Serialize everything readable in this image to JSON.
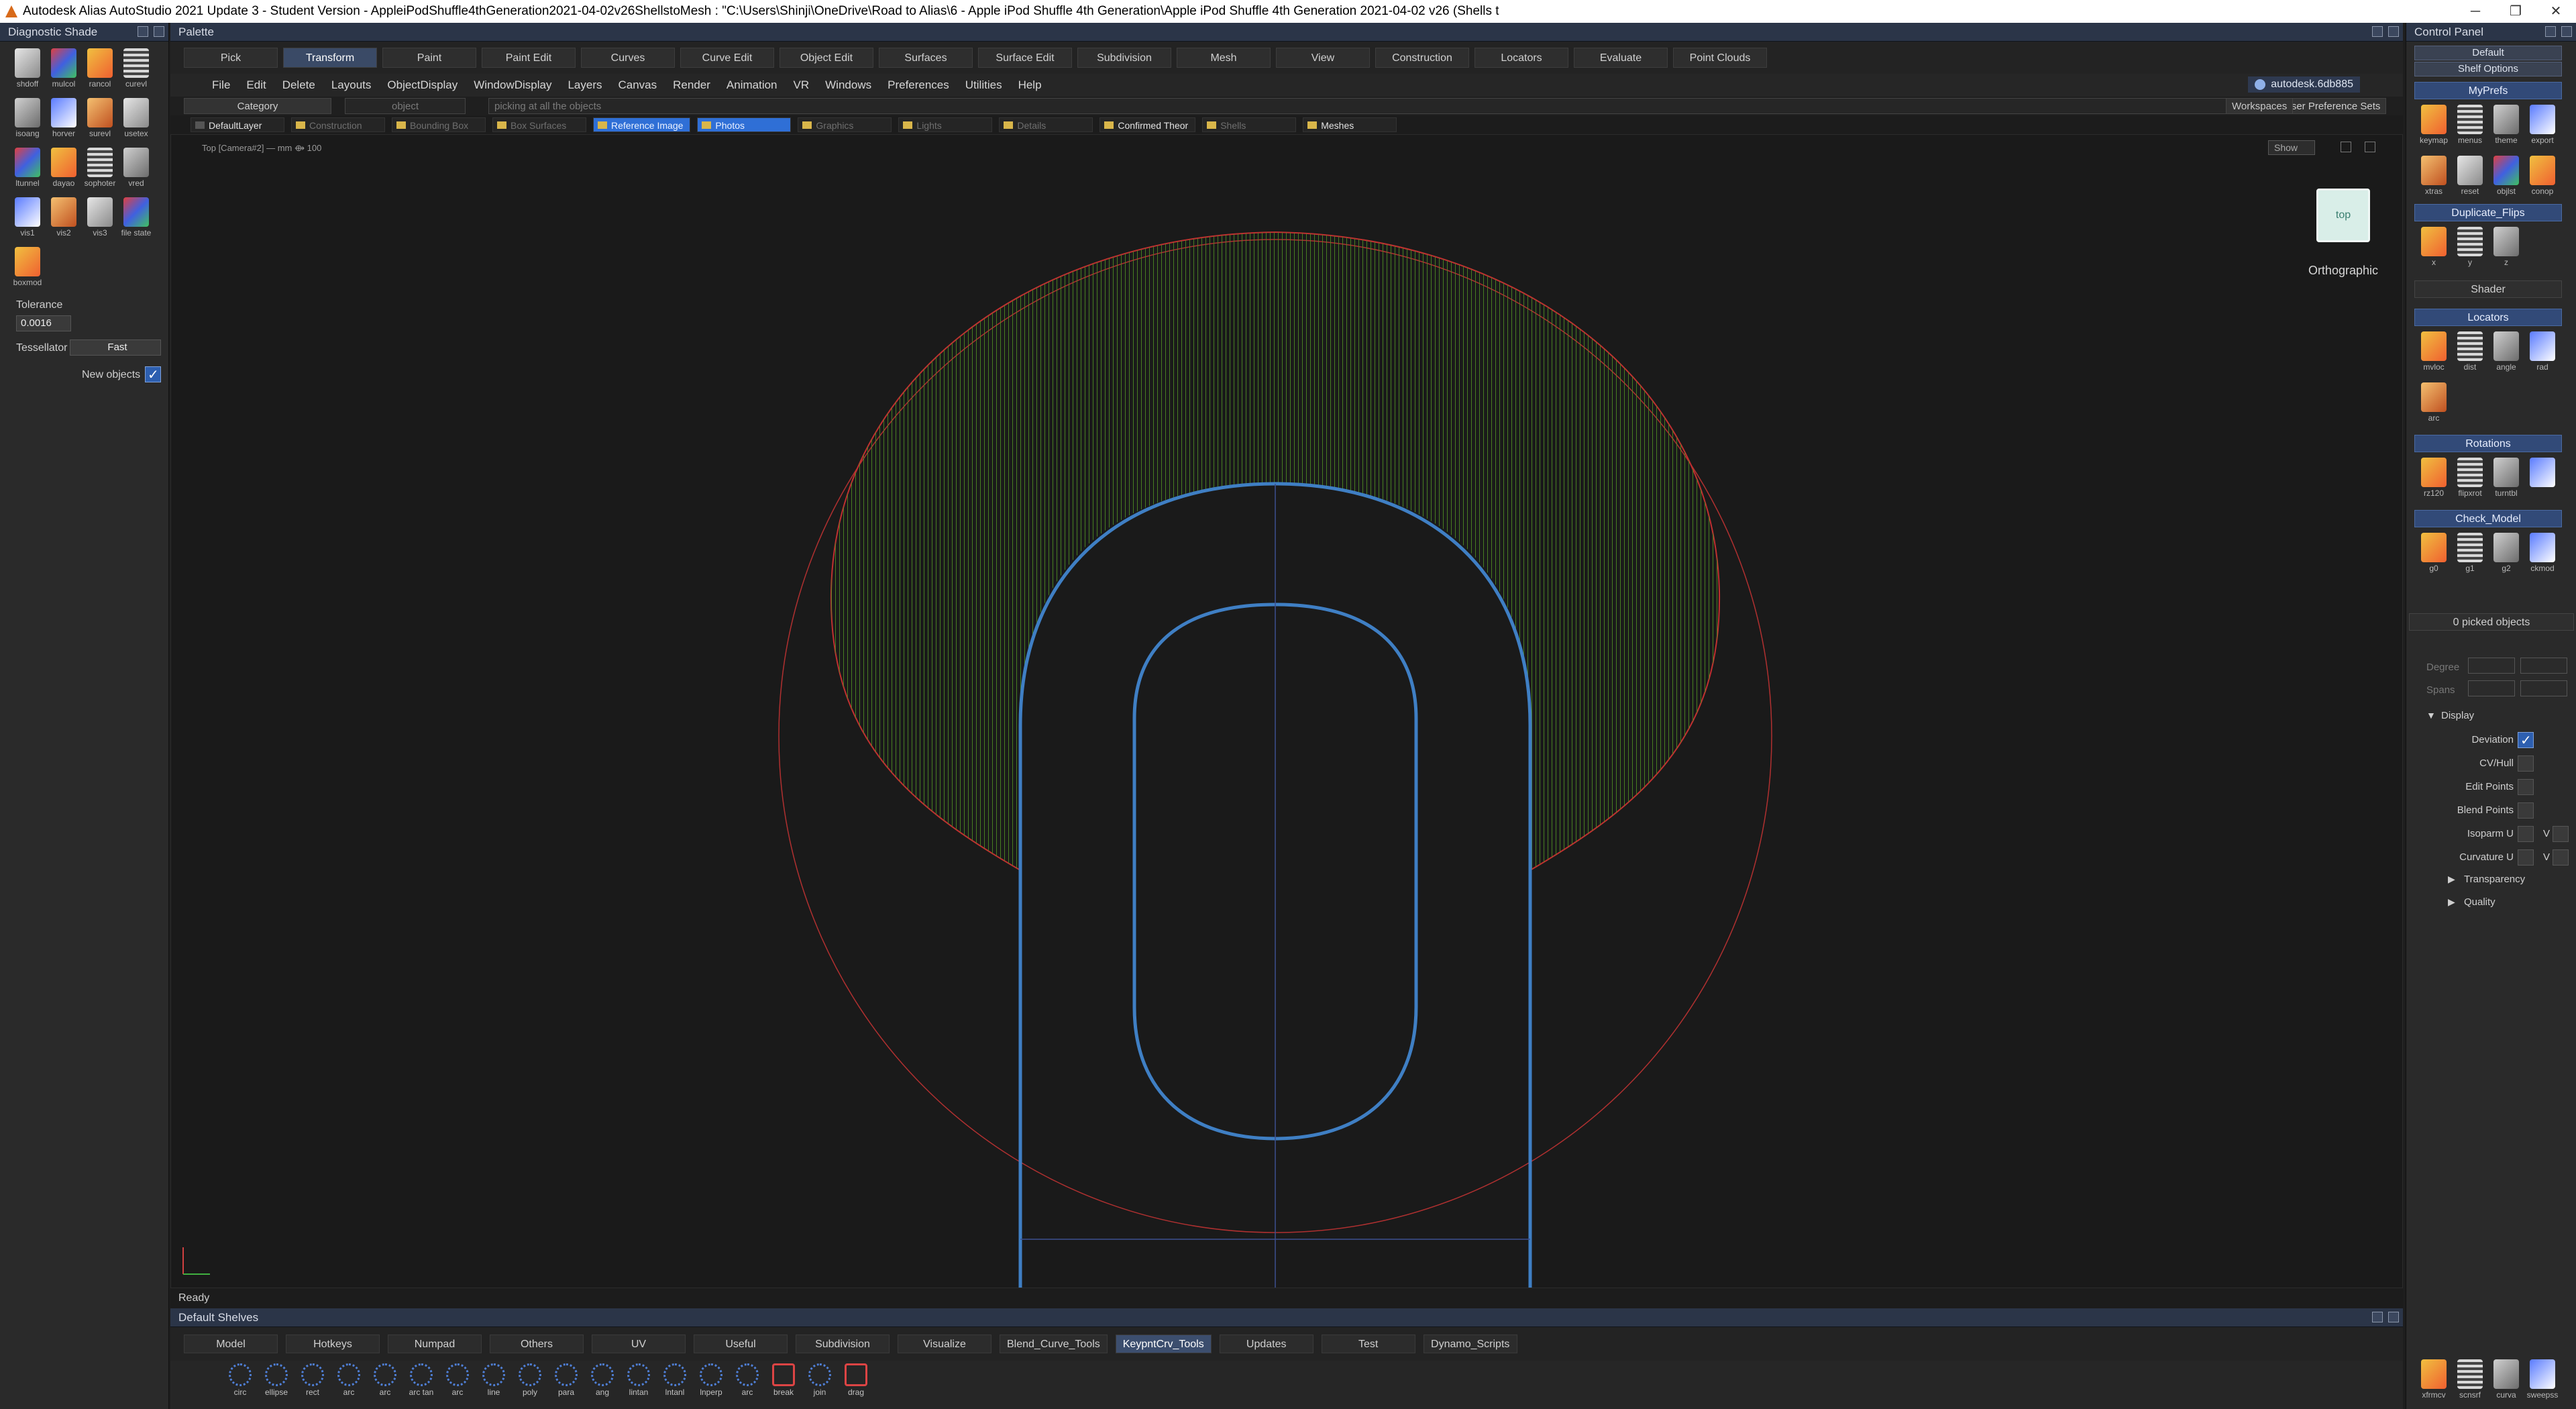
{
  "window": {
    "title": "Autodesk Alias AutoStudio 2021 Update 3 - Student Version   - AppleiPodShuffle4thGeneration2021-04-02v26ShellstoMesh : \"C:\\Users\\Shinji\\OneDrive\\Road to Alias\\6 - Apple iPod Shuffle 4th Generation\\Apple iPod Shuffle 4th Generation 2021-04-02 v26 (Shells t",
    "controls": [
      "─",
      "❐",
      "✕"
    ]
  },
  "left_palette": {
    "title": "Diagnostic Shade",
    "tools": [
      "shdoff",
      "mulcol",
      "rancol",
      "curevl",
      "isoang",
      "horver",
      "surevl",
      "usetex",
      "ltunnel",
      "dayao",
      "sophoter",
      "vred",
      "vis1",
      "vis2",
      "vis3",
      "file state",
      "boxmod"
    ],
    "tolerance_label": "Tolerance",
    "tolerance_value": "0.0016",
    "tessellator_label": "Tessellator",
    "tessellator_value": "Fast",
    "new_objects_label": "New objects"
  },
  "palette": {
    "title": "Palette",
    "tabs": [
      "Pick",
      "Transform",
      "Paint",
      "Paint Edit",
      "Curves",
      "Curve Edit",
      "Object Edit",
      "Surfaces",
      "Surface Edit",
      "Subdivision",
      "Mesh",
      "View",
      "Construction",
      "Locators",
      "Evaluate",
      "Point Clouds"
    ],
    "active_tab": "Transform"
  },
  "menubar": {
    "items": [
      "File",
      "Edit",
      "Delete",
      "Layouts",
      "ObjectDisplay",
      "WindowDisplay",
      "Layers",
      "Canvas",
      "Render",
      "Animation",
      "VR",
      "Windows",
      "Preferences",
      "Utilities",
      "Help"
    ],
    "user": "autodesk.6db885",
    "object_label": "object"
  },
  "picker": {
    "category": "Category",
    "object": "object",
    "picking_hint": "picking at all the objects",
    "user_pref_sets": "User Preference Sets",
    "workspaces": "Workspaces"
  },
  "layers": [
    {
      "name": "DefaultLayer",
      "state": "on"
    },
    {
      "name": "Construction",
      "state": "off"
    },
    {
      "name": "Bounding Box",
      "state": "off"
    },
    {
      "name": "Box Surfaces",
      "state": "off"
    },
    {
      "name": "Reference Image",
      "state": "sel"
    },
    {
      "name": "Photos",
      "state": "sel"
    },
    {
      "name": "Graphics",
      "state": "off"
    },
    {
      "name": "Lights",
      "state": "off"
    },
    {
      "name": "Details",
      "state": "off"
    },
    {
      "name": "Confirmed Theor",
      "state": "on"
    },
    {
      "name": "Shells",
      "state": "off"
    },
    {
      "name": "Meshes",
      "state": "on"
    }
  ],
  "viewport": {
    "camera": "Top [Camera#2] — mm    ⟴ 100",
    "show": "Show",
    "view_cube": "top",
    "projection": "Orthographic",
    "colors": {
      "outline": "#c03030",
      "comb": "#5a9a2a",
      "curve": "#3f7fc4",
      "axis": "#3d4f8f"
    }
  },
  "status": "Ready",
  "shelves": {
    "title": "Default Shelves",
    "tabs": [
      "Model",
      "Hotkeys",
      "Numpad",
      "Others",
      "UV",
      "Useful",
      "Subdivision",
      "Visualize",
      "Blend_Curve_Tools",
      "KeypntCrv_Tools",
      "Updates",
      "Test",
      "Dynamo_Scripts"
    ],
    "active_tab": "KeypntCrv_Tools",
    "tools": [
      "circ",
      "ellipse",
      "rect",
      "arc",
      "arc",
      "arc tan",
      "arc",
      "line",
      "poly",
      "para",
      "ang",
      "lintan",
      "lntanl",
      "lnperp",
      "arc",
      "break",
      "join",
      "drag"
    ]
  },
  "control_panel": {
    "title": "Control Panel",
    "preset": "Default",
    "shelf_options": "Shelf Options",
    "sections": {
      "myprefs": {
        "title": "MyPrefs",
        "tools": [
          "keymap",
          "menus",
          "theme",
          "export",
          "xtras",
          "reset",
          "objlst",
          "conop"
        ]
      },
      "duplicate": {
        "title": "Duplicate_Flips",
        "tools": [
          "x",
          "y",
          "z"
        ]
      },
      "shader": "Shader",
      "locators": {
        "title": "Locators",
        "tools": [
          "mvloc",
          "dist",
          "angle",
          "rad",
          "arc"
        ]
      },
      "rotations": {
        "title": "Rotations",
        "tools": [
          "rz120",
          "flipxrot",
          "turntbl",
          ""
        ]
      },
      "check_model": {
        "title": "Check_Model",
        "tools": [
          "g0",
          "g1",
          "g2",
          "ckmod"
        ]
      }
    },
    "picked": "0 picked objects",
    "degree_label": "Degree",
    "spans_label": "Spans",
    "display_label": "Display",
    "display_items": [
      "Deviation",
      "CV/Hull",
      "Edit Points",
      "Blend Points",
      "Isoparm U",
      "Curvature U"
    ],
    "v_label": "V",
    "transparency": "Transparency",
    "quality": "Quality",
    "bottom_tools": [
      "xfrmcv",
      "scnsrf",
      "curva",
      "sweepss"
    ]
  }
}
